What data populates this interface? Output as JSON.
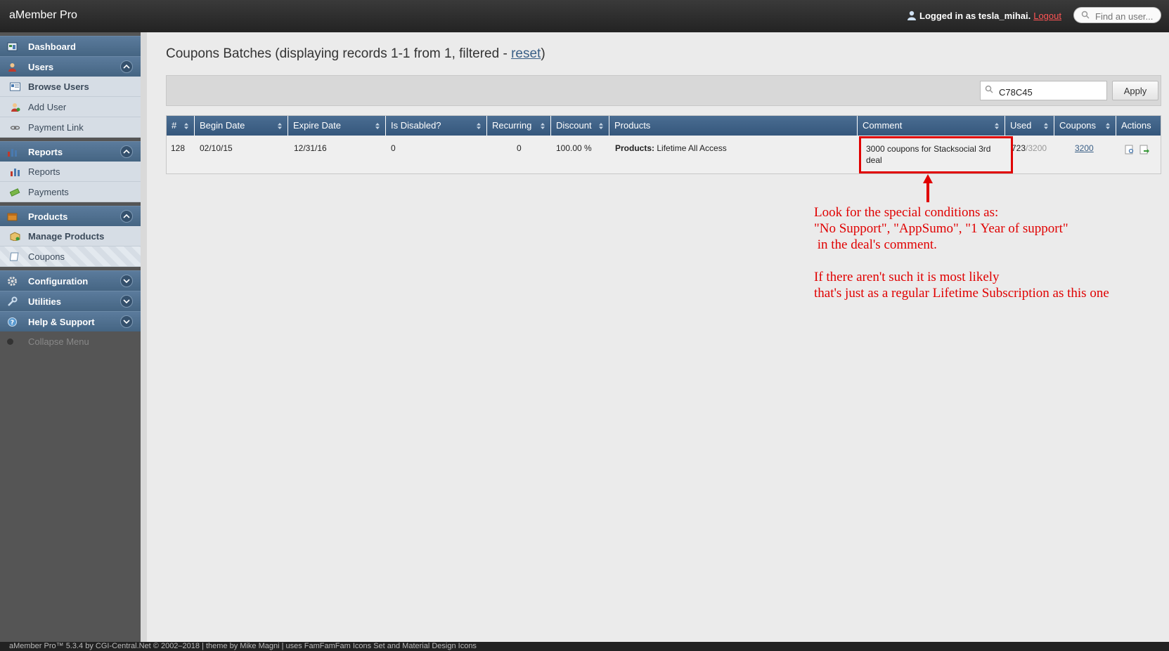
{
  "app": {
    "title": "aMember Pro",
    "logged_in_text": "Logged in as tesla_mihai.",
    "logout_label": "Logout",
    "find_user_placeholder": "Find an user..."
  },
  "sidebar": {
    "dashboard": "Dashboard",
    "users": {
      "label": "Users",
      "items": [
        "Browse Users",
        "Add User",
        "Payment Link"
      ]
    },
    "reports": {
      "label": "Reports",
      "items": [
        "Reports",
        "Payments"
      ]
    },
    "products": {
      "label": "Products",
      "items": [
        "Manage Products",
        "Coupons"
      ]
    },
    "configuration": "Configuration",
    "utilities": "Utilities",
    "help": "Help & Support",
    "collapse": "Collapse Menu"
  },
  "page": {
    "title_prefix": "Coupons Batches (displaying records 1-1 from 1, filtered - ",
    "title_link": "reset",
    "title_suffix": ")"
  },
  "filter": {
    "value": "C78C45",
    "apply_label": "Apply"
  },
  "table": {
    "headers": [
      "#",
      "Begin Date",
      "Expire Date",
      "Is Disabled?",
      "Recurring",
      "Discount",
      "Products",
      "Comment",
      "Used",
      "Coupons",
      "Actions"
    ],
    "row": {
      "id": "128",
      "begin_date": "02/10/15",
      "expire_date": "12/31/16",
      "is_disabled": "0",
      "recurring": "0",
      "discount": "100.00 %",
      "products_label": "Products:",
      "products_value": "Lifetime All Access",
      "comment": "3000 coupons for Stacksocial 3rd deal",
      "used": "723",
      "used_total": "/3200",
      "coupons": "3200"
    }
  },
  "annotation": {
    "note": "Look for the special conditions as:\n\"No Support\", \"AppSumo\", \"1 Year of support\"\n in the deal's comment.\n\nIf there aren't such it is most likely\nthat's just as a regular Lifetime Subscription as this one",
    "color": "#e00000"
  },
  "footer": "aMember Pro™ 5.3.4 by CGI-Central.Net © 2002–2018 | theme by Mike Magni | uses FamFamFam Icons Set and Material Design Icons"
}
